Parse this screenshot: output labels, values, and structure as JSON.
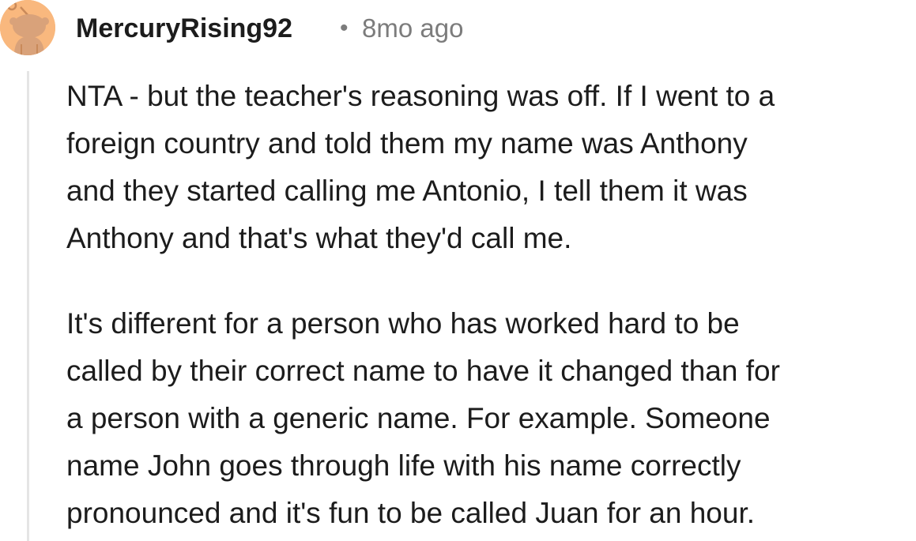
{
  "comment": {
    "author": "MercuryRising92",
    "separator": "•",
    "timestamp": "8mo ago",
    "avatar_icon": "reddit-snoo-avatar-icon",
    "paragraphs": [
      {
        "lines": [
          "NTA - but the teacher's reasoning was off. If I went to a",
          "foreign country and told them my name was Anthony",
          "and they started calling me Antonio, I tell them it was",
          "Anthony and that's what they'd call me."
        ]
      },
      {
        "lines": [
          "It's different for a person who has worked hard to be",
          "called by their correct name to have it changed than for",
          "a person with a generic name. For example. Someone",
          "name John goes through life with his name correctly",
          "pronounced and it's fun to be called Juan for an hour."
        ]
      }
    ]
  },
  "colors": {
    "avatar_bg": "#f9b87e",
    "text": "#1c1c1c",
    "meta_text": "#7c7c7c",
    "thread_line": "#e5e5e5"
  }
}
